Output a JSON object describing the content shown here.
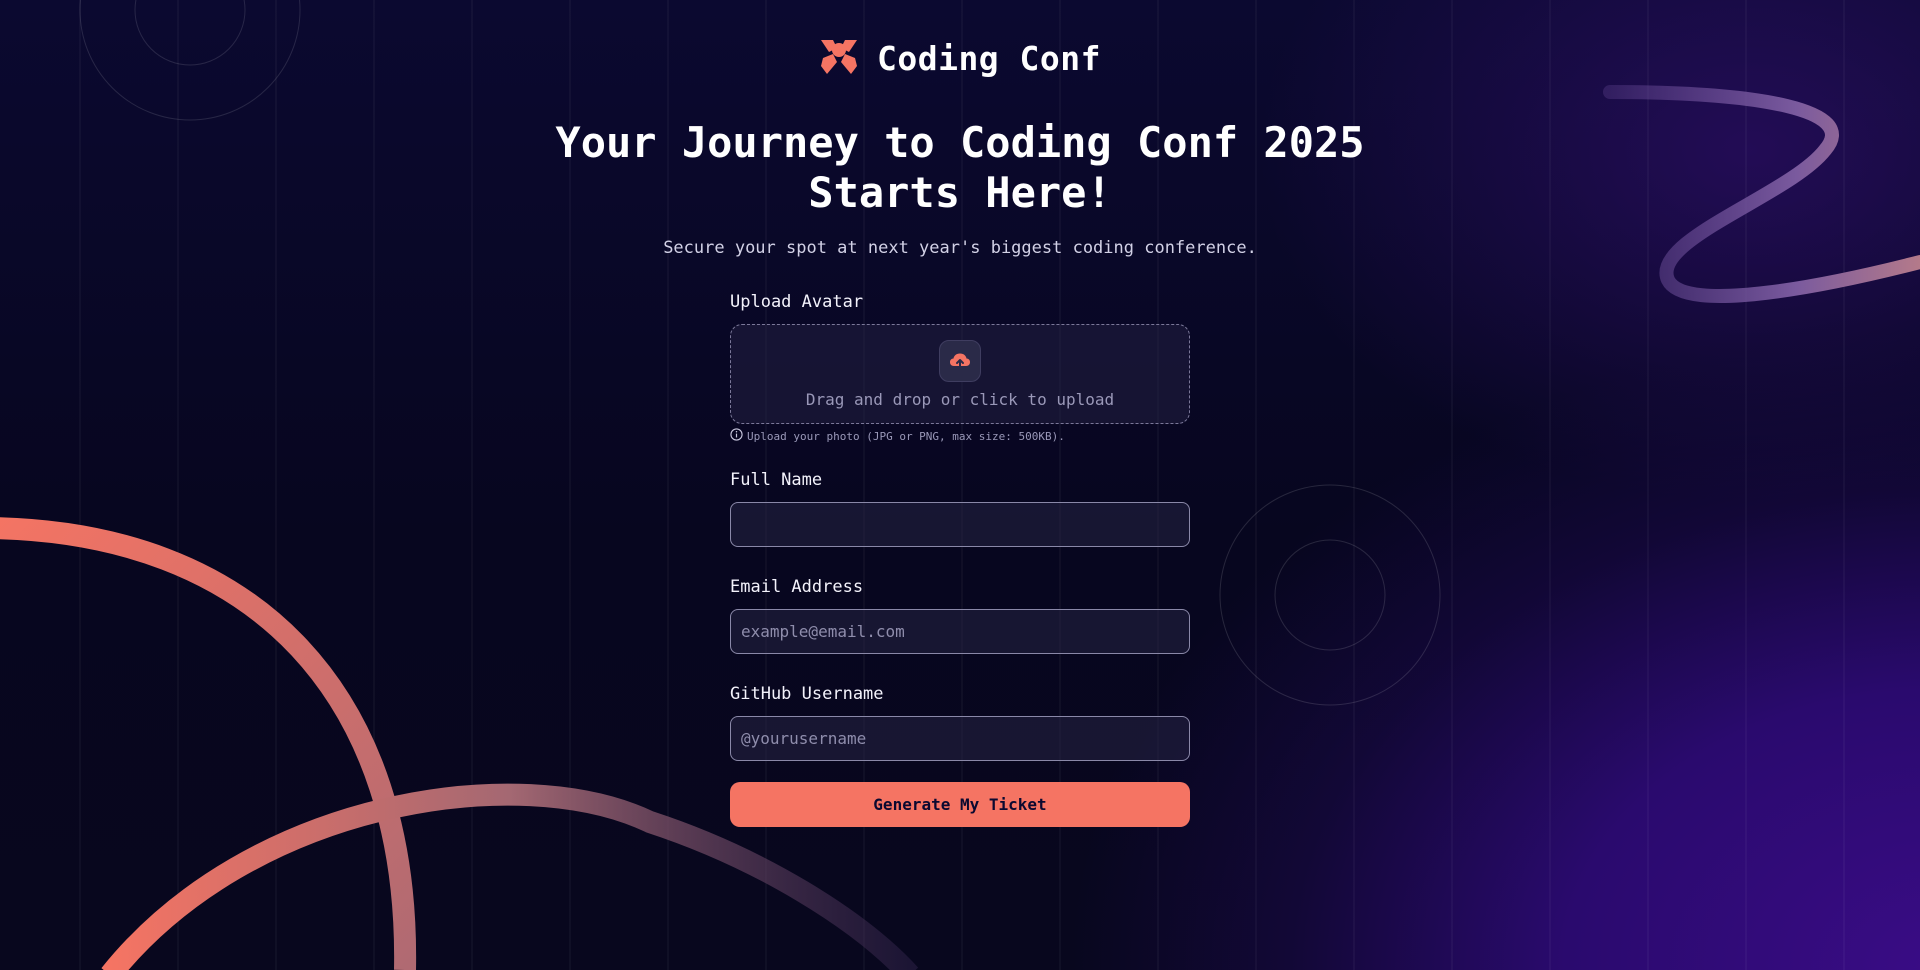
{
  "brand": {
    "name": "Coding Conf",
    "logo_icon": "coding-conf-logo-icon"
  },
  "hero": {
    "headline_line1": "Your Journey to Coding Conf 2025",
    "headline_line2": "Starts Here!",
    "subheadline": "Secure your spot at next year's biggest coding conference."
  },
  "form": {
    "avatar": {
      "label": "Upload Avatar",
      "dropzone_text": "Drag and drop or click to upload",
      "icon": "cloud-upload-icon",
      "hint_icon": "info-icon",
      "hint": "Upload your photo (JPG or PNG, max size: 500KB)."
    },
    "full_name": {
      "label": "Full Name",
      "value": "",
      "placeholder": ""
    },
    "email": {
      "label": "Email Address",
      "value": "",
      "placeholder": "example@email.com"
    },
    "github": {
      "label": "GitHub Username",
      "value": "",
      "placeholder": "@yourusername"
    },
    "submit_label": "Generate My Ticket"
  },
  "colors": {
    "accent": "#f57463",
    "background_dark": "#0b0930",
    "background_purple": "#3a0c86"
  }
}
